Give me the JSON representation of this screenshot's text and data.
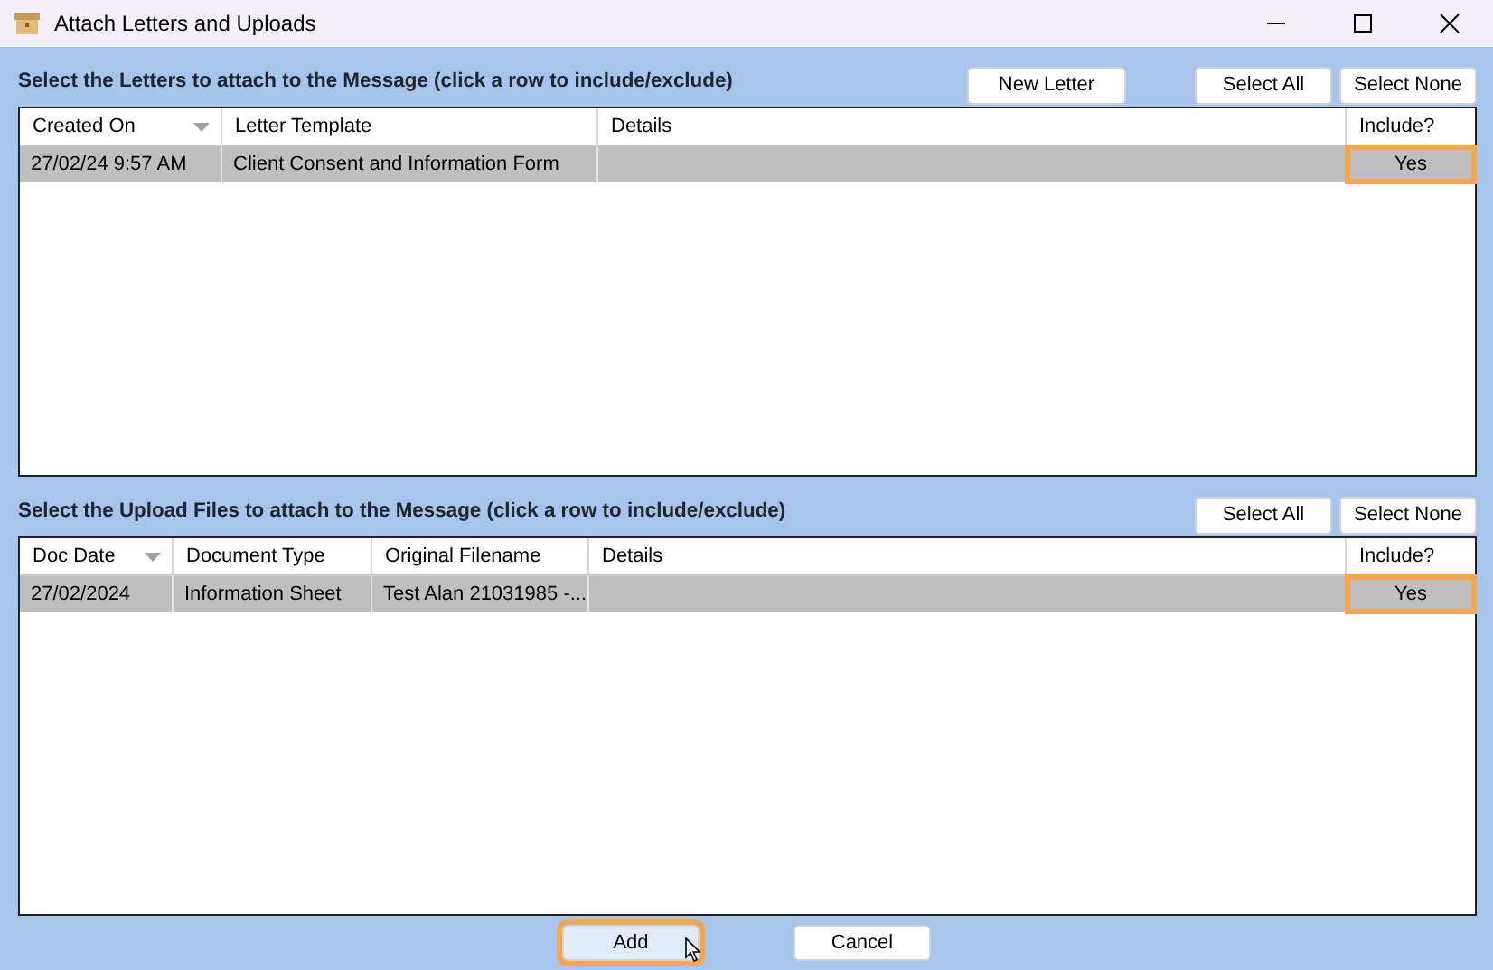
{
  "window": {
    "title": "Attach Letters and Uploads"
  },
  "sections": [
    {
      "title": "Select the Letters to attach to the Message (click a row to include/exclude)",
      "buttons": [
        {
          "label": "New Letter",
          "kind": "separate"
        },
        {
          "label": "Select All",
          "kind": "group"
        },
        {
          "label": "Select None",
          "kind": "group"
        }
      ],
      "columns": [
        {
          "label": "Created On",
          "sorted": true
        },
        {
          "label": "Letter Template",
          "sorted": false
        },
        {
          "label": "Details",
          "sorted": false
        },
        {
          "label": "Include?",
          "sorted": false
        }
      ],
      "rows": [
        {
          "cells": [
            "27/02/24 9:57 AM",
            "Client Consent and Information Form",
            "",
            "Yes"
          ],
          "selected": true,
          "highlighted": true
        }
      ]
    },
    {
      "title": "Select the Upload Files to attach to the Message (click a row to include/exclude)",
      "buttons": [
        {
          "label": "Select All",
          "kind": "group"
        },
        {
          "label": "Select None",
          "kind": "group"
        }
      ],
      "columns": [
        {
          "label": "Doc Date",
          "sorted": true
        },
        {
          "label": "Document Type",
          "sorted": false
        },
        {
          "label": "Original Filename",
          "sorted": false
        },
        {
          "label": "Details",
          "sorted": false
        },
        {
          "label": "Include?",
          "sorted": false
        }
      ],
      "rows": [
        {
          "cells": [
            "27/02/2024",
            "Information Sheet",
            "Test Alan 21031985 -...",
            "",
            "Yes"
          ],
          "selected": true,
          "highlighted": true
        }
      ]
    }
  ],
  "footer": [
    {
      "label": "Add",
      "highlighted": true,
      "hovered": true
    },
    {
      "label": "Cancel",
      "highlighted": false,
      "hovered": false
    }
  ]
}
